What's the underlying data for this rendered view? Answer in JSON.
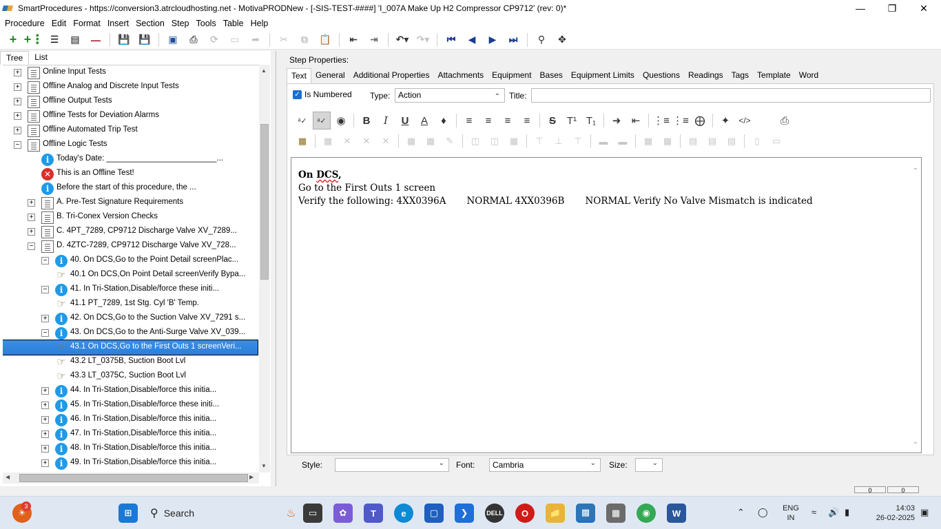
{
  "window": {
    "title": "SmartProcedures - https://conversion3.atrcloudhosting.net - MotivaPRODNew - [-SIS-TEST-####] 'I_007A Make Up H2 Compressor CP9712' (rev: 0)*"
  },
  "menu": [
    "Procedure",
    "Edit",
    "Format",
    "Insert",
    "Section",
    "Step",
    "Tools",
    "Table",
    "Help"
  ],
  "left_tabs": [
    "Tree",
    "List"
  ],
  "tree": [
    {
      "label": "Online Input Tests",
      "icon": "folder-icon",
      "expander": "+"
    },
    {
      "label": "Offline Analog and Discrete Input Tests",
      "icon": "folder-icon",
      "expander": "+"
    },
    {
      "label": "Offline Output Tests",
      "icon": "folder-icon",
      "expander": "+"
    },
    {
      "label": "Offline Tests for Deviation Alarms",
      "icon": "folder-icon",
      "expander": "+"
    },
    {
      "label": "Offline Automated Trip Test",
      "icon": "folder-icon",
      "expander": "+"
    },
    {
      "label": "Offline Logic Tests",
      "icon": "folder-icon",
      "expander": "−"
    },
    {
      "label": "Today's Date: _________________________...",
      "icon": "info-icon",
      "expander": ""
    },
    {
      "label": "This is an Offline Test!",
      "icon": "error-icon",
      "expander": ""
    },
    {
      "label": "Before the start of this procedure, the ...",
      "icon": "info-icon",
      "expander": ""
    },
    {
      "label": "A. Pre-Test Signature Requirements",
      "icon": "folder-icon",
      "expander": "+"
    },
    {
      "label": "B. Tri-Conex Version Checks",
      "icon": "folder-icon",
      "expander": "+"
    },
    {
      "label": "C. 4PT_7289, CP9712 Discharge Valve XV_7289...",
      "icon": "folder-icon",
      "expander": "+"
    },
    {
      "label": "D. 4ZTC-7289, CP9712 Discharge Valve XV_728...",
      "icon": "folder-icon",
      "expander": "−"
    },
    {
      "label": "40. On DCS,Go to the Point Detail screenPlac...",
      "icon": "info-icon",
      "expander": "−"
    },
    {
      "label": "40.1 On DCS,On Point Detail screenVerify Bypa...",
      "icon": "hand-icon",
      "expander": ""
    },
    {
      "label": "41. In Tri-Station,Disable/force these initi...",
      "icon": "info-icon",
      "expander": "−"
    },
    {
      "label": "41.1 PT_7289, 1st Stg. Cyl 'B' Temp.",
      "icon": "hand-icon",
      "expander": ""
    },
    {
      "label": "42. On DCS,Go to the Suction Valve XV_7291 s...",
      "icon": "info-icon",
      "expander": "+"
    },
    {
      "label": "43. On DCS,Go to the Anti-Surge Valve XV_039...",
      "icon": "info-icon",
      "expander": "−"
    },
    {
      "label": "43.1 On DCS,Go to the First Outs 1 screenVeri...",
      "icon": "hand-icon",
      "expander": ""
    },
    {
      "label": "43.2 LT_0375B, Suction Boot Lvl",
      "icon": "hand-icon",
      "expander": ""
    },
    {
      "label": "43.3 LT_0375C, Suction Boot Lvl",
      "icon": "hand-icon",
      "expander": ""
    },
    {
      "label": "44. In Tri-Station,Disable/force this initia...",
      "icon": "info-icon",
      "expander": "+"
    },
    {
      "label": "45. In Tri-Station,Disable/force these initi...",
      "icon": "info-icon",
      "expander": "+"
    },
    {
      "label": "46. In Tri-Station,Disable/force this initia...",
      "icon": "info-icon",
      "expander": "+"
    },
    {
      "label": "47. In Tri-Station,Disable/force this initia...",
      "icon": "info-icon",
      "expander": "+"
    },
    {
      "label": "48. In Tri-Station,Disable/force this initia...",
      "icon": "info-icon",
      "expander": "+"
    },
    {
      "label": "49. In Tri-Station,Disable/force this initia...",
      "icon": "info-icon",
      "expander": "+"
    }
  ],
  "tree_selected_index": 19,
  "step_props": {
    "label": "Step Properties:",
    "tabs": [
      "Text",
      "General",
      "Additional Properties",
      "Attachments",
      "Equipment",
      "Bases",
      "Equipment Limits",
      "Questions",
      "Readings",
      "Tags",
      "Template",
      "Word"
    ],
    "is_numbered_label": "Is Numbered",
    "is_numbered": true,
    "type_label": "Type:",
    "type_value": "Action",
    "title_label": "Title:",
    "title_value": ""
  },
  "editor": {
    "line1_prefix": "On ",
    "line1_word": "DCS",
    "line1_suffix": ",",
    "line2": "Go to the First Outs 1 screen",
    "line3": "Verify the following: 4XX0396A       NORMAL 4XX0396B       NORMAL Verify No Valve Mismatch is indicated"
  },
  "bottom": {
    "style_label": "Style:",
    "style_value": "",
    "font_label": "Font:",
    "font_value": "Cambria",
    "size_label": "Size:",
    "size_value": ""
  },
  "status": {
    "box1": "0",
    "box2": "0"
  },
  "taskbar": {
    "search_label": "Search",
    "notification_count": "3",
    "lang_line1": "ENG",
    "lang_line2": "IN",
    "time": "14:03",
    "date": "26-02-2025"
  }
}
